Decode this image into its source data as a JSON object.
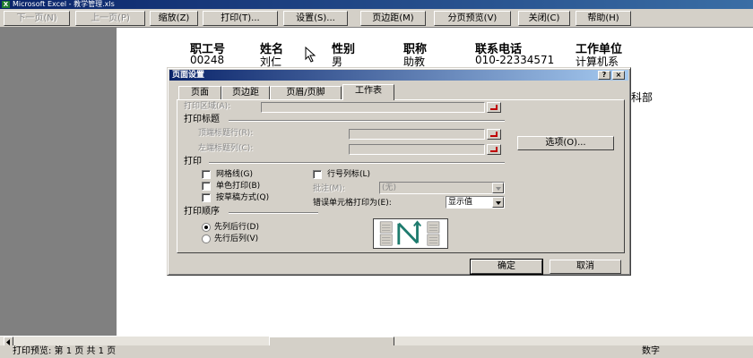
{
  "window": {
    "title": "Microsoft Excel - 教学管理.xls"
  },
  "toolbar": {
    "next_page": "下一页(N)",
    "prev_page": "上一页(P)",
    "zoom": "缩放(Z)",
    "print": "打印(T)...",
    "setup": "设置(S)...",
    "margins": "页边距(M)",
    "page_break_preview": "分页预览(V)",
    "close": "关闭(C)",
    "help": "帮助(H)"
  },
  "sheet": {
    "headers": [
      "职工号",
      "姓名",
      "性别",
      "职称",
      "联系电话",
      "工作单位"
    ],
    "row1": [
      "00248",
      "刘仁",
      "男",
      "助教",
      "010-22334571",
      "计算机系"
    ],
    "partial_text": "科部"
  },
  "dialog": {
    "title": "页面设置",
    "help_btn": "?",
    "close_btn": "×",
    "tabs": [
      "页面",
      "页边距",
      "页眉/页脚",
      "工作表"
    ],
    "print_area_label": "打印区域(A):",
    "print_titles_group": "打印标题",
    "rows_repeat_label": "顶端标题行(R):",
    "cols_repeat_label": "左端标题列(C):",
    "print_group": "打印",
    "gridlines": "网格线(G)",
    "black_white": "单色打印(B)",
    "draft_quality": "按草稿方式(Q)",
    "row_col_headings": "行号列标(L)",
    "comments_label": "批注(M):",
    "comments_value": "(无)",
    "cell_errors_label": "错误单元格打印为(E):",
    "cell_errors_value": "显示值",
    "page_order_group": "打印顺序",
    "down_then_over": "先列后行(D)",
    "over_then_down": "先行后列(V)",
    "options_btn": "选项(O)...",
    "ok_btn": "确定",
    "cancel_btn": "取消"
  },
  "status": {
    "left": "打印预览: 第 1 页  共 1 页",
    "right": "数字"
  }
}
